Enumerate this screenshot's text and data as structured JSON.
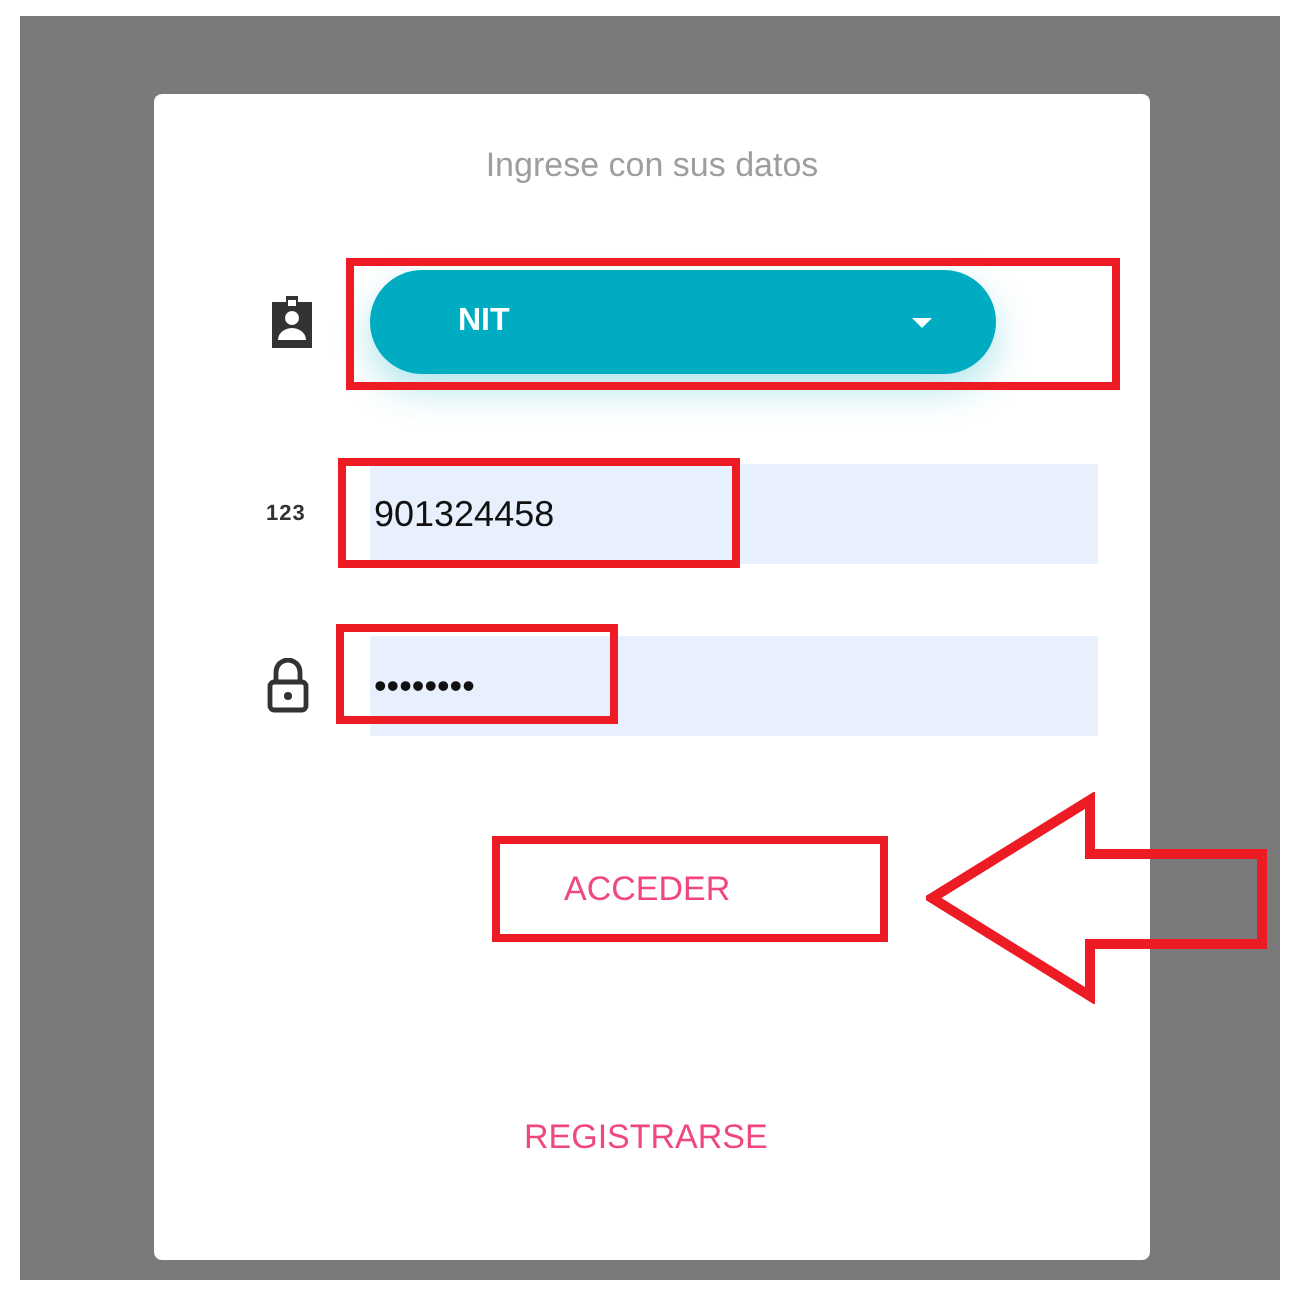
{
  "title": "Ingrese con sus datos",
  "fields": [
    {
      "kind": "select",
      "value": "NIT",
      "highlighted": true
    },
    {
      "kind": "number",
      "icon_text": "123",
      "value": "901324458",
      "highlighted": true
    },
    {
      "kind": "password",
      "value": "••••••••",
      "highlighted": true
    }
  ],
  "actions": [
    {
      "label": "ACCEDER",
      "highlighted": true,
      "pointed_at": true
    },
    {
      "label": "REGISTRARSE",
      "highlighted": false
    }
  ]
}
